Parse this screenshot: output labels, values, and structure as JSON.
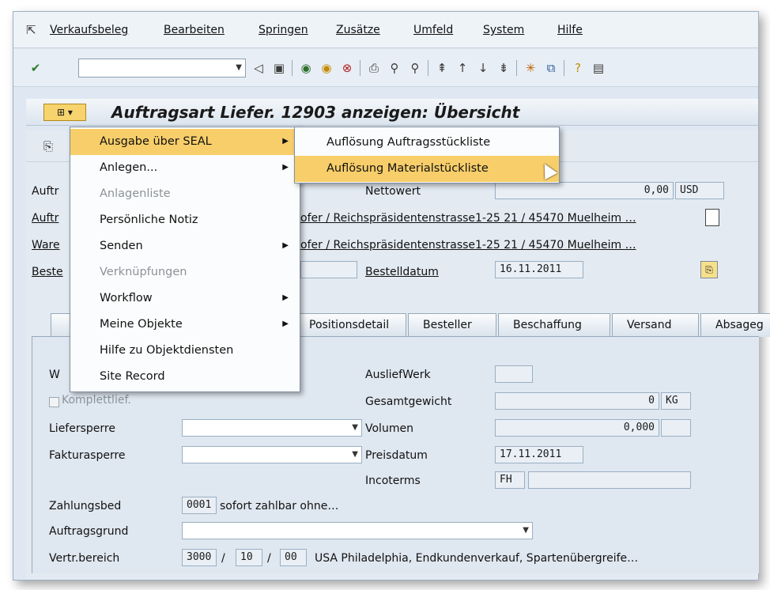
{
  "menubar": {
    "items": [
      "Verkaufsbeleg",
      "Bearbeiten",
      "Springen",
      "Zusätze",
      "Umfeld",
      "System",
      "Hilfe"
    ]
  },
  "toolbar": {
    "command_value": "",
    "icons": [
      "enter-icon",
      "back-icon",
      "save-icon",
      "back-nav-icon",
      "exit-icon",
      "cancel-icon",
      "print-icon",
      "find-icon",
      "find-next-icon",
      "first-page-icon",
      "prev-page-icon",
      "next-page-icon",
      "last-page-icon",
      "new-session-icon",
      "shortcut-icon",
      "help-icon",
      "layout-icon"
    ]
  },
  "title": "Auftragsart Liefer. 12903 anzeigen: Übersicht",
  "header_fields": {
    "left_labels": [
      "Auftr",
      "Auftr",
      "Ware",
      "Beste"
    ],
    "nettowert_label": "Nettowert",
    "nettowert_value": "0,00",
    "currency": "USD",
    "auftraggeber_text": "ofer / Reichspräsidentenstrasse1-25 21 / 45470 Muelheim …",
    "warenempf_text": "ofer / Reichspräsidentenstrasse1-25 21 / 45470 Muelheim …",
    "bestelldatum_label": "Bestelldatum",
    "bestelldatum_value": "16.11.2011"
  },
  "tabs": [
    "Positionsdetail",
    "Besteller",
    "Beschaffung",
    "Versand",
    "Absageg"
  ],
  "panel": {
    "w_label": "W",
    "komplettlief": "Komplettlief.",
    "liefersperre": "Liefersperre",
    "fakturasperre": "Fakturasperre",
    "ausliefwerk_label": "AusliefWerk",
    "gesamtgewicht_label": "Gesamtgewicht",
    "gesamtgewicht_value": "0",
    "gesamtgewicht_unit": "KG",
    "volumen_label": "Volumen",
    "volumen_value": "0,000",
    "preisdatum_label": "Preisdatum",
    "preisdatum_value": "17.11.2011",
    "incoterms_label": "Incoterms",
    "incoterms_value": "FH",
    "zahlungsbed_label": "Zahlungsbed",
    "zahlungsbed_code": "0001",
    "zahlungsbed_text": "sofort zahlbar ohne…",
    "auftragsgrund_label": "Auftragsgrund",
    "vertrbereich_label": "Vertr.bereich",
    "vkorg": "3000",
    "vtweg": "10",
    "sparte": "00",
    "vertrbereich_text": "USA Philadelphia, Endkundenverkauf, Spartenübergreife…"
  },
  "context_menu": {
    "items": [
      {
        "label": "Ausgabe über SEAL",
        "submenu": true,
        "highlighted": true,
        "disabled": false
      },
      {
        "label": "Anlegen...",
        "submenu": true,
        "highlighted": false,
        "disabled": false
      },
      {
        "label": "Anlagenliste",
        "submenu": false,
        "highlighted": false,
        "disabled": true
      },
      {
        "label": "Persönliche Notiz",
        "submenu": false,
        "highlighted": false,
        "disabled": false
      },
      {
        "label": "Senden",
        "submenu": true,
        "highlighted": false,
        "disabled": false
      },
      {
        "label": "Verknüpfungen",
        "submenu": false,
        "highlighted": false,
        "disabled": true
      },
      {
        "label": "Workflow",
        "submenu": true,
        "highlighted": false,
        "disabled": false
      },
      {
        "label": "Meine Objekte",
        "submenu": true,
        "highlighted": false,
        "disabled": false
      },
      {
        "label": "Hilfe zu Objektdiensten",
        "submenu": false,
        "highlighted": false,
        "disabled": false
      },
      {
        "label": "Site Record",
        "submenu": false,
        "highlighted": false,
        "disabled": false
      }
    ]
  },
  "submenu": {
    "items": [
      "Auflösung Auftragsstückliste",
      "Auflösung Materialstückliste"
    ],
    "highlighted_index": 1
  },
  "colors": {
    "highlight": "#f7ce6a",
    "window_bg": "#dfe8f2"
  }
}
